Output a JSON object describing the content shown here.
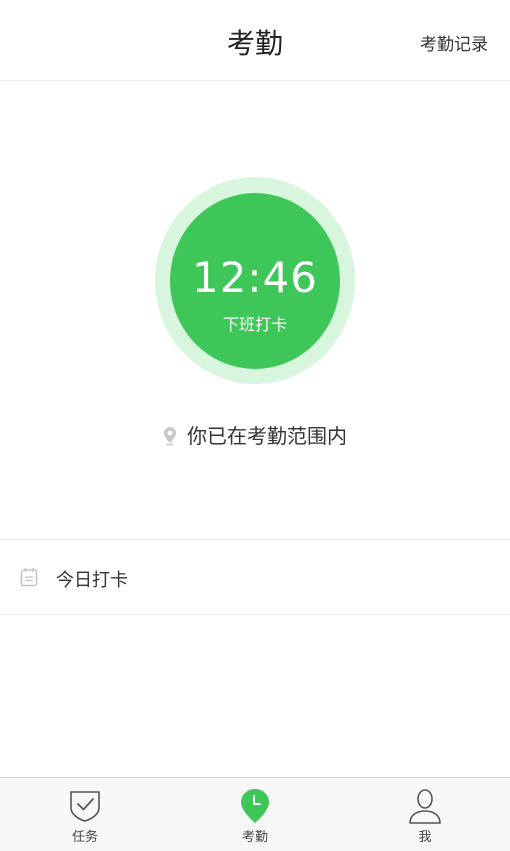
{
  "header": {
    "title": "考勤",
    "record_link": "考勤记录"
  },
  "punch": {
    "time": "12:46",
    "label": "下班打卡"
  },
  "location": {
    "status_text": "你已在考勤范围内"
  },
  "today": {
    "label": "今日打卡"
  },
  "tabbar": {
    "tabs": [
      {
        "label": "任务",
        "icon": "shield-check-icon"
      },
      {
        "label": "考勤",
        "icon": "location-clock-icon",
        "active": true
      },
      {
        "label": "我",
        "icon": "person-icon"
      }
    ]
  },
  "colors": {
    "accent": "#3fc659",
    "accent_light": "#d8f5dd"
  }
}
